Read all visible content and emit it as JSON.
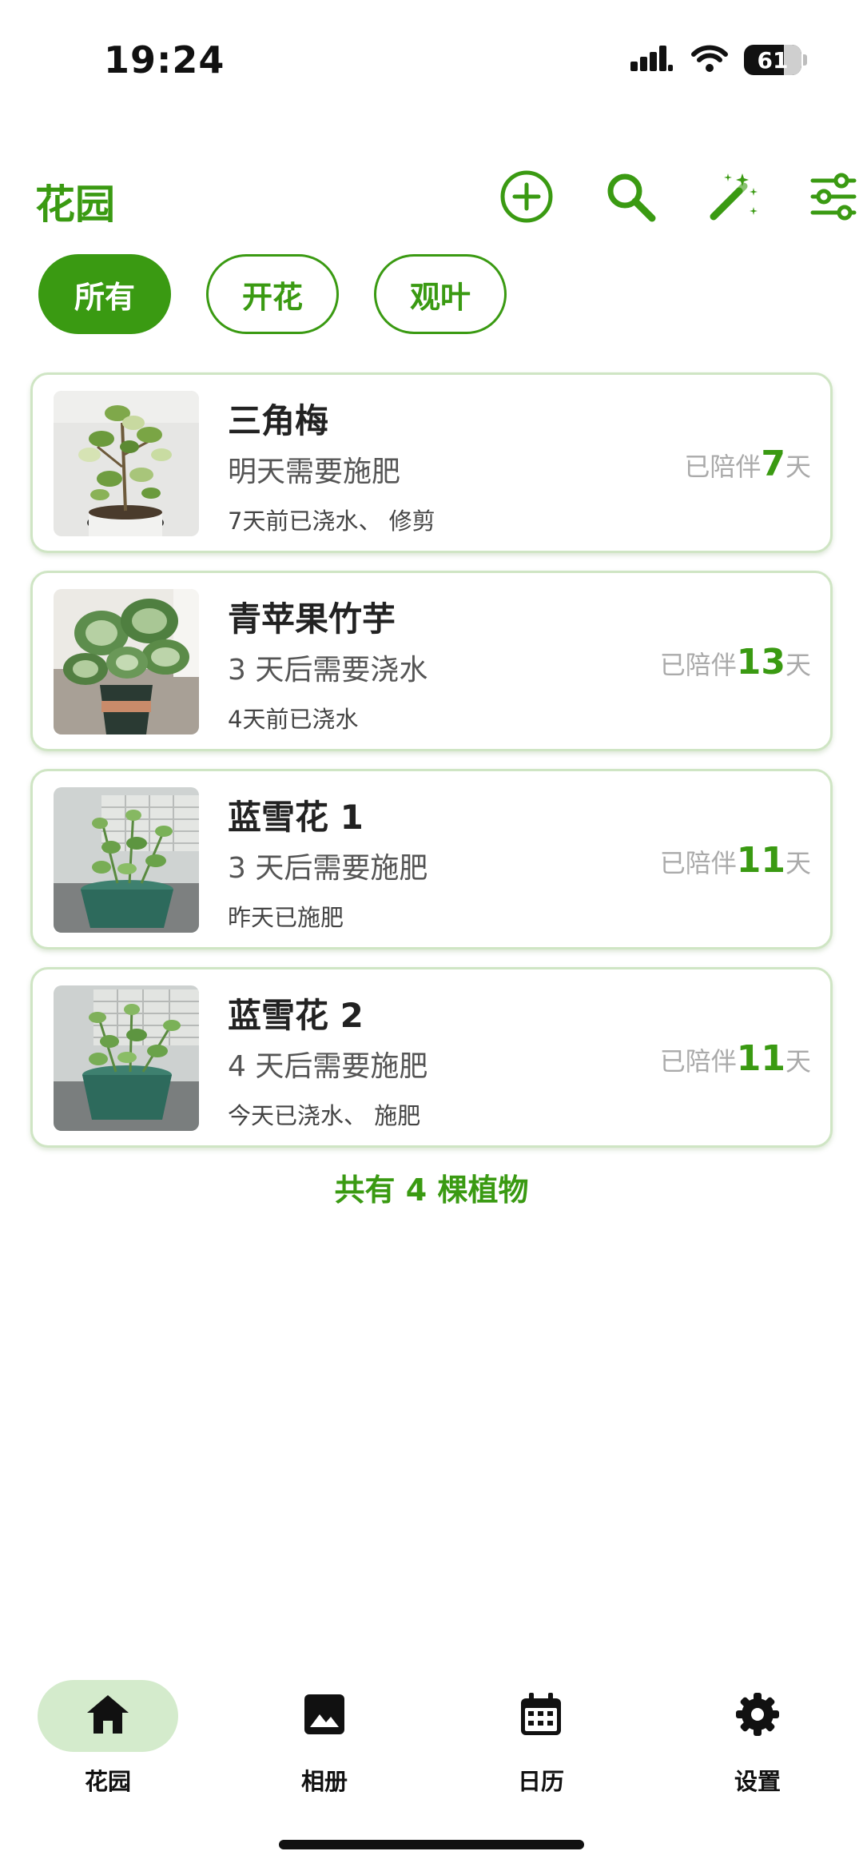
{
  "status_bar": {
    "time": "19:24",
    "battery": "61"
  },
  "header": {
    "title": "花园",
    "actions": [
      "add-icon",
      "search-icon",
      "magic-wand-icon",
      "filter-sliders-icon"
    ]
  },
  "filters": [
    {
      "label": "所有",
      "active": true
    },
    {
      "label": "开花",
      "active": false
    },
    {
      "label": "观叶",
      "active": false
    }
  ],
  "plants": [
    {
      "name": "三角梅",
      "task": "明天需要施肥",
      "history": "7天前已浇水、 修剪",
      "days_prefix": "已陪伴",
      "days": "7",
      "days_suffix": "天"
    },
    {
      "name": "青苹果竹芋",
      "task": "3 天后需要浇水",
      "history": "4天前已浇水",
      "days_prefix": "已陪伴",
      "days": "13",
      "days_suffix": "天"
    },
    {
      "name": "蓝雪花 1",
      "task": "3 天后需要施肥",
      "history": "昨天已施肥",
      "days_prefix": "已陪伴",
      "days": "11",
      "days_suffix": "天"
    },
    {
      "name": "蓝雪花 2",
      "task": "4 天后需要施肥",
      "history": "今天已浇水、 施肥",
      "days_prefix": "已陪伴",
      "days": "11",
      "days_suffix": "天"
    }
  ],
  "summary": "共有 4 棵植物",
  "nav": [
    {
      "label": "花园",
      "icon": "home-icon",
      "active": true
    },
    {
      "label": "相册",
      "icon": "image-icon",
      "active": false
    },
    {
      "label": "日历",
      "icon": "calendar-icon",
      "active": false
    },
    {
      "label": "设置",
      "icon": "gear-icon",
      "active": false
    }
  ],
  "colors": {
    "accent": "#3a9a12",
    "card_border": "#cfe5c4",
    "nav_active_bg": "#d4ebcc"
  }
}
